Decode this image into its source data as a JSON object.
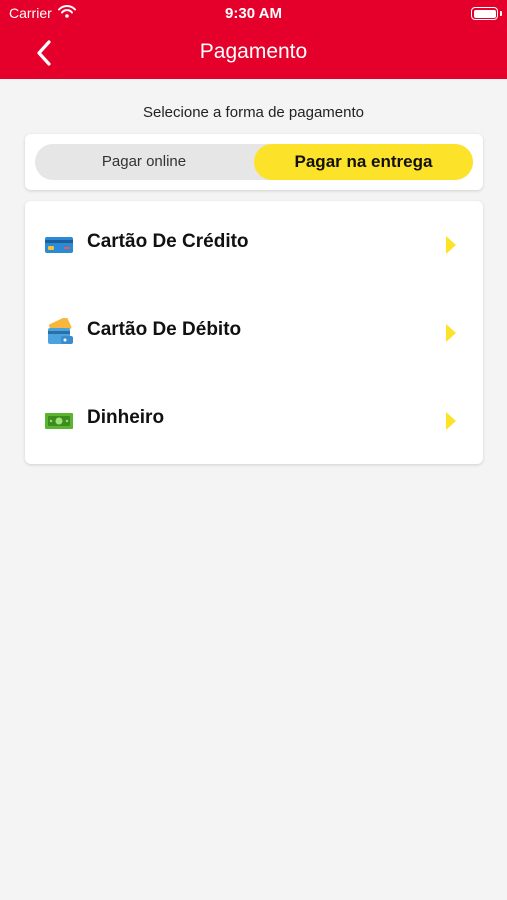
{
  "status_bar": {
    "carrier": "Carrier",
    "time": "9:30 AM"
  },
  "header": {
    "title": "Pagamento",
    "back_icon": "chevron-left-icon"
  },
  "subtitle": "Selecione a forma de pagamento",
  "toggle": {
    "options": [
      {
        "label": "Pagar online",
        "selected": false
      },
      {
        "label": "Pagar na entrega",
        "selected": true
      }
    ]
  },
  "payment_methods": [
    {
      "label": "Cartão De Crédito",
      "icon": "credit-card-icon"
    },
    {
      "label": "Cartão De Débito",
      "icon": "debit-card-icon"
    },
    {
      "label": "Dinheiro",
      "icon": "cash-icon"
    }
  ],
  "colors": {
    "header": "#e4002b",
    "accent": "#fde22a",
    "background": "#f4f4f4"
  }
}
